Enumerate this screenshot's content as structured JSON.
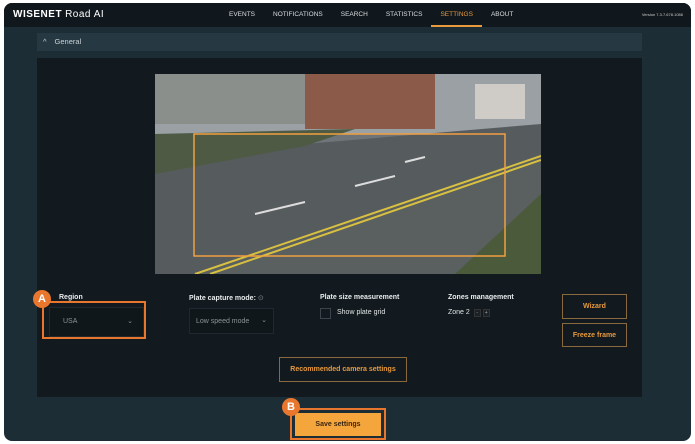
{
  "header": {
    "brand": "WISENET",
    "product": "Road AI",
    "nav": [
      "EVENTS",
      "NOTIFICATIONS",
      "SEARCH",
      "STATISTICS",
      "SETTINGS",
      "ABOUT"
    ],
    "active": "SETTINGS",
    "version": "Version 7.3.7.678.1086"
  },
  "section": {
    "title": "General"
  },
  "region": {
    "label": "Region",
    "value": "USA"
  },
  "capture": {
    "label": "Plate capture mode:",
    "value": "Low speed mode"
  },
  "plate_size": {
    "label": "Plate size measurement",
    "checkbox_label": "Show plate grid",
    "checked": false
  },
  "zones": {
    "label": "Zones management",
    "zone": "Zone 2",
    "minus": "-",
    "plus": "+"
  },
  "buttons": {
    "wizard": "Wizard",
    "freeze": "Freeze frame",
    "recommended": "Recommended camera settings",
    "save": "Save settings"
  },
  "annotations": {
    "a": "A",
    "b": "B"
  },
  "colors": {
    "accent": "#e89a3c",
    "highlight": "#e8762c"
  }
}
